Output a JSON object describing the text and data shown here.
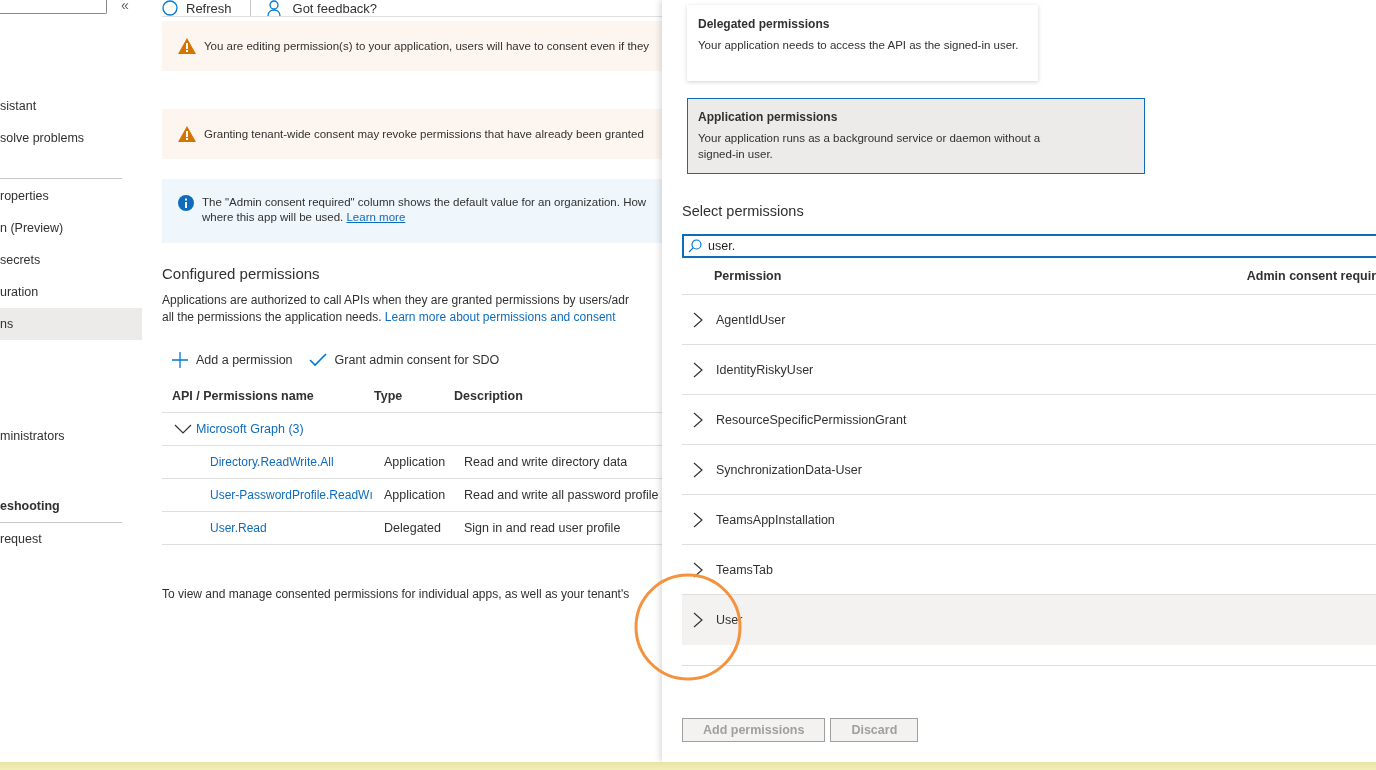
{
  "nav": {
    "collapse": "«",
    "groups": [
      {
        "items": [
          {
            "label": "sistant",
            "selected": false,
            "bold": false
          },
          {
            "label": "solve problems",
            "selected": false,
            "bold": false
          }
        ]
      },
      {
        "items": [
          {
            "label": "roperties",
            "selected": false,
            "bold": false
          },
          {
            "label": "n (Preview)",
            "selected": false,
            "bold": false
          },
          {
            "label": "secrets",
            "selected": false,
            "bold": false
          },
          {
            "label": "uration",
            "selected": false,
            "bold": false
          },
          {
            "label": "ns",
            "selected": true,
            "bold": false
          }
        ]
      },
      {
        "items": [
          {
            "label": "ministrators",
            "selected": false,
            "bold": false
          }
        ]
      },
      {
        "items": [
          {
            "label": "eshooting",
            "selected": false,
            "bold": true
          }
        ]
      },
      {
        "items": [
          {
            "label": "request",
            "selected": false,
            "bold": false
          }
        ]
      }
    ]
  },
  "toolbar": [
    {
      "label": "Refresh"
    },
    {
      "label": "Got feedback?"
    }
  ],
  "banners": [
    {
      "kind": "warning",
      "text": "You are editing permission(s) to your application, users will have to consent even if they"
    },
    {
      "kind": "warning",
      "text": "Granting tenant-wide consent may revoke permissions that have already been granted"
    },
    {
      "kind": "info",
      "text": "The \"Admin consent required\" column shows the default value for an organization. How",
      "text2": "where this app will be used.",
      "link": "Learn more"
    }
  ],
  "configured": {
    "title": "Configured permissions",
    "text1": "Applications are authorized to call APIs when they are granted permissions by users/adr",
    "text2": "all the permissions the application needs.",
    "link": "Learn more about permissions and consent"
  },
  "actions": [
    {
      "label": "Add a permission"
    },
    {
      "label": "Grant admin consent for SDO"
    }
  ],
  "table": {
    "columns": [
      "API / Permissions name",
      "Type",
      "Description"
    ],
    "group": {
      "label": "Microsoft Graph (3)",
      "expanded": true
    },
    "rows": [
      {
        "name": "Directory.ReadWrite.All",
        "type": "Application",
        "description": "Read and write directory data"
      },
      {
        "name": "User-PasswordProfile.ReadWı",
        "type": "Application",
        "description": "Read and write all password profile"
      },
      {
        "name": "User.Read",
        "type": "Delegated",
        "description": "Sign in and read user profile"
      }
    ]
  },
  "footer_text": "To view and manage consented permissions for individual apps, as well as your tenant's",
  "panel": {
    "types": [
      {
        "title": "Delegated permissions",
        "description": "Your application needs to access the API as the signed-in user.",
        "selected": false
      },
      {
        "title": "Application permissions",
        "description": "Your application runs as a background service or daemon without a signed-in user.",
        "selected": true
      }
    ],
    "select_title": "Select permissions",
    "search": {
      "value": "user."
    },
    "columns": [
      "Permission",
      "Admin consent requir"
    ],
    "permissions": [
      {
        "name": "AgentIdUser",
        "highlighted": false
      },
      {
        "name": "IdentityRiskyUser",
        "highlighted": false
      },
      {
        "name": "ResourceSpecificPermissionGrant",
        "highlighted": false
      },
      {
        "name": "SynchronizationData-User",
        "highlighted": false
      },
      {
        "name": "TeamsAppInstallation",
        "highlighted": false
      },
      {
        "name": "TeamsTab",
        "highlighted": false
      },
      {
        "name": "User",
        "highlighted": true
      }
    ],
    "buttons": [
      {
        "label": "Add permissions",
        "disabled": true
      },
      {
        "label": "Discard",
        "disabled": true
      }
    ]
  }
}
